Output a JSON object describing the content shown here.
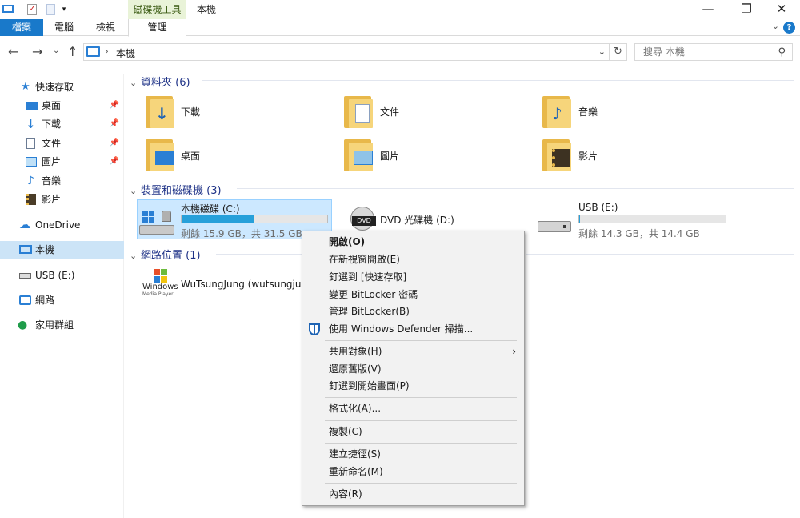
{
  "window": {
    "title": "本機",
    "tool_tab_header": "磁碟機工具",
    "controls": {
      "minimize": "—",
      "maximize": "❐",
      "close": "✕"
    }
  },
  "ribbon": {
    "tabs": [
      "檔案",
      "電腦",
      "檢視",
      "管理"
    ],
    "help": "?"
  },
  "address_bar": {
    "separator": "›",
    "location": "本機",
    "search_placeholder": "搜尋 本機"
  },
  "sidebar": {
    "items": [
      {
        "label": "快速存取",
        "icon": "star-icon",
        "pinned": false
      },
      {
        "label": "桌面",
        "icon": "desktop-icon",
        "pinned": true
      },
      {
        "label": "下載",
        "icon": "download-icon",
        "pinned": true
      },
      {
        "label": "文件",
        "icon": "document-icon",
        "pinned": true
      },
      {
        "label": "圖片",
        "icon": "picture-icon",
        "pinned": true
      },
      {
        "label": "音樂",
        "icon": "music-icon",
        "pinned": false
      },
      {
        "label": "影片",
        "icon": "video-icon",
        "pinned": false
      },
      {
        "label": "OneDrive",
        "icon": "cloud-icon",
        "pinned": false
      },
      {
        "label": "本機",
        "icon": "computer-icon",
        "pinned": false,
        "selected": true
      },
      {
        "label": "USB (E:)",
        "icon": "usb-drive-icon",
        "pinned": false
      },
      {
        "label": "網路",
        "icon": "network-icon",
        "pinned": false
      },
      {
        "label": "家用群組",
        "icon": "homegroup-icon",
        "pinned": false
      }
    ]
  },
  "folders_group": {
    "title": "資料夾 (6)",
    "items": [
      {
        "label": "下載",
        "icon": "download-folder-icon"
      },
      {
        "label": "文件",
        "icon": "documents-folder-icon"
      },
      {
        "label": "音樂",
        "icon": "music-folder-icon"
      },
      {
        "label": "桌面",
        "icon": "desktop-folder-icon"
      },
      {
        "label": "圖片",
        "icon": "pictures-folder-icon"
      },
      {
        "label": "影片",
        "icon": "videos-folder-icon"
      }
    ]
  },
  "devices_group": {
    "title": "裝置和磁碟機 (3)",
    "drives": [
      {
        "name": "本機磁碟 (C:)",
        "free_text": "剩餘 15.9 GB，共 31.5 GB",
        "used_fraction": 0.5,
        "icon": "windows-drive-icon"
      },
      {
        "name": "DVD 光碟機 (D:)",
        "icon": "dvd-drive-icon"
      },
      {
        "name": "USB (E:)",
        "free_text": "剩餘 14.3 GB，共 14.4 GB",
        "used_fraction": 0.007,
        "icon": "usb-drive-icon"
      }
    ]
  },
  "network_group": {
    "title": "網路位置 (1)",
    "items": [
      {
        "label": "WuTsungJung (wutsungjung",
        "logo_line1": "Windows",
        "logo_line2": "Media Player"
      }
    ]
  },
  "context_menu": {
    "items": [
      {
        "label": "開啟(O)",
        "bold": true
      },
      {
        "label": "在新視窗開啟(E)"
      },
      {
        "label": "釘選到 [快速存取]"
      },
      {
        "label": "變更 BitLocker 密碼"
      },
      {
        "label": "管理 BitLocker(B)"
      },
      {
        "label": "使用 Windows Defender 掃描...",
        "icon": "shield-icon"
      },
      {
        "separator": true
      },
      {
        "label": "共用對象(H)",
        "submenu": true
      },
      {
        "label": "還原舊版(V)"
      },
      {
        "label": "釘選到開始畫面(P)"
      },
      {
        "separator": true
      },
      {
        "label": "格式化(A)..."
      },
      {
        "separator": true
      },
      {
        "label": "複製(C)"
      },
      {
        "separator": true
      },
      {
        "label": "建立捷徑(S)"
      },
      {
        "label": "重新命名(M)"
      },
      {
        "separator": true
      },
      {
        "label": "內容(R)"
      }
    ],
    "submenu_arrow": "›"
  },
  "colors": {
    "accent": "#1979ca",
    "selection": "#cce8ff",
    "drive_bar": "#26a0da",
    "group_heading": "#1e3287",
    "tool_tab": "#e9f3d8"
  }
}
